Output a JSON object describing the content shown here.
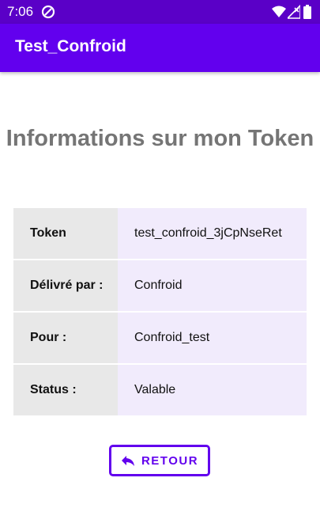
{
  "status_bar": {
    "time": "7:06",
    "icons": [
      "data-saver-icon",
      "wifi-icon",
      "signal-icon",
      "battery-icon"
    ]
  },
  "app_bar": {
    "title": "Test_Confroid"
  },
  "main": {
    "title": "Informations sur mon Token",
    "rows": [
      {
        "label": "Token",
        "value": "test_confroid_3jCpNseRet"
      },
      {
        "label": "Délivré par :",
        "value": "Confroid"
      },
      {
        "label": "Pour :",
        "value": "Confroid_test"
      },
      {
        "label": "Status :",
        "value": "Valable"
      }
    ],
    "back_button": {
      "label": "RETOUR",
      "icon": "reply-arrow-icon"
    }
  },
  "colors": {
    "status_bar": "#5a00c7",
    "app_bar": "#6200ee",
    "accent": "#6200ee",
    "title_text": "#757575",
    "label_bg": "#e8e8e8",
    "value_bg": "#f1ebfc"
  }
}
